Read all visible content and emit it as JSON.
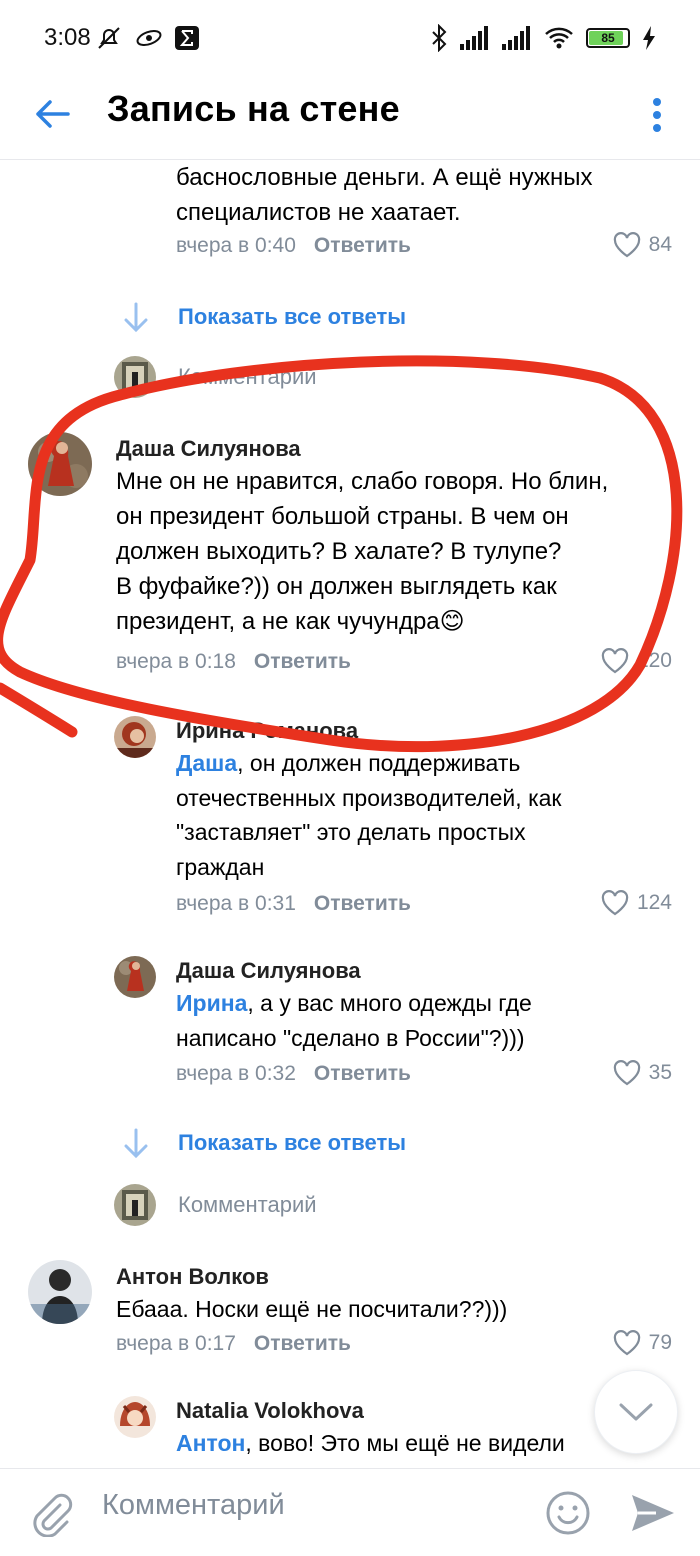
{
  "status_bar": {
    "time": "3:08",
    "battery": "85",
    "icons": [
      "mute-icon",
      "vpn-icon",
      "sigma-icon",
      "bluetooth-icon",
      "signal-icon",
      "signal-icon",
      "wifi-icon",
      "battery-icon",
      "charging-icon"
    ]
  },
  "header": {
    "title": "Запись на стене"
  },
  "comments": [
    {
      "text_lines": [
        "баснословные деньги. А ещё нужных",
        "специалистов не хаатает."
      ],
      "time": "вчера в 0:40",
      "reply": "Ответить",
      "likes": "84"
    },
    {
      "author": "Даша Силуянова",
      "text_lines": [
        "Мне он не нравится, слабо говоря. Но блин,",
        "он президент большой страны. В чем он",
        "должен выходить? В халате? В тулупе?",
        "В фуфайке?)) он должен выглядеть как",
        "президент, а не как чучундра"
      ],
      "emoji": "😊",
      "time": "вчера в 0:18",
      "reply": "Ответить",
      "likes": "120"
    },
    {
      "author": "Ирина Романова",
      "mention": "Даша",
      "text_lines": [
        ", он должен поддерживать",
        "отечественных производителей, как",
        "\"заставляет\" это делать простых",
        "граждан"
      ],
      "time": "вчера в 0:31",
      "reply": "Ответить",
      "likes": "124"
    },
    {
      "author": "Даша Силуянова",
      "mention": "Ирина",
      "text_lines": [
        ", а у вас много одежды где",
        "написано \"сделано в России\"?)))"
      ],
      "time": "вчера в 0:32",
      "reply": "Ответить",
      "likes": "35"
    },
    {
      "author": "Антон Волков",
      "text_lines": [
        "Ебааа. Носки ещё не посчитали??)))"
      ],
      "time": "вчера в 0:17",
      "reply": "Ответить",
      "likes": "79"
    },
    {
      "author": "Natalia Volokhova",
      "mention": "Антон",
      "text_lines": [
        ", вово! Это мы ещё не видели"
      ]
    }
  ],
  "show_all_replies": "Показать все ответы",
  "reply_placeholder": "Комментарий",
  "bottom_bar": {
    "placeholder": "Комментарий"
  },
  "colors": {
    "accent": "#2d81e0",
    "secondary_text": "#818c99",
    "annotation": "#e8321e",
    "battery_fill": "#6fd25a"
  }
}
